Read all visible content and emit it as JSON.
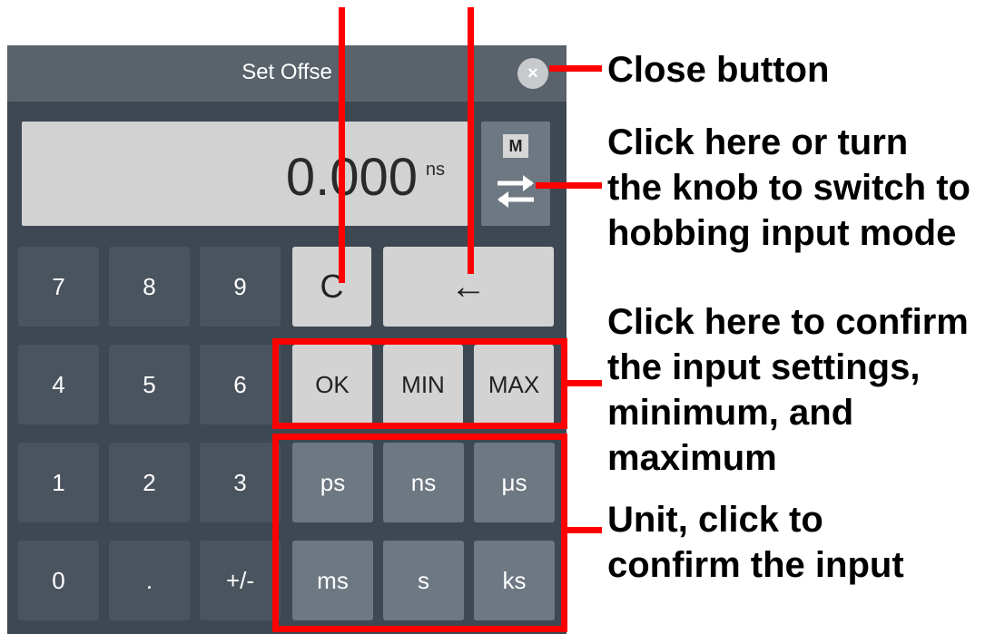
{
  "dialog": {
    "title": "Set Offse",
    "close_symbol": "×",
    "display_value": "0.000",
    "display_unit": "ns",
    "mode_label": "M",
    "mode_icon": "swap-arrows-icon"
  },
  "keys": {
    "k7": "7",
    "k8": "8",
    "k9": "9",
    "clear": "C",
    "backspace": "←",
    "k4": "4",
    "k5": "5",
    "k6": "6",
    "ok": "OK",
    "min": "MIN",
    "max": "MAX",
    "k1": "1",
    "k2": "2",
    "k3": "3",
    "ps": "ps",
    "ns": "ns",
    "us": "μs",
    "k0": "0",
    "dot": ".",
    "sign": "+/-",
    "ms": "ms",
    "s": "s",
    "ks": "ks"
  },
  "annotations": {
    "close": "Close button",
    "mode": "Click here or turn\nthe knob to switch to\nhobbing input mode",
    "confirm": "Click here to confirm\nthe input settings,\nminimum, and\nmaximum",
    "unit": "Unit, click to\nconfirm the input"
  },
  "colors": {
    "panel": "#3e4852",
    "titlebar": "#5a626b",
    "annotation": "#ff0000"
  }
}
